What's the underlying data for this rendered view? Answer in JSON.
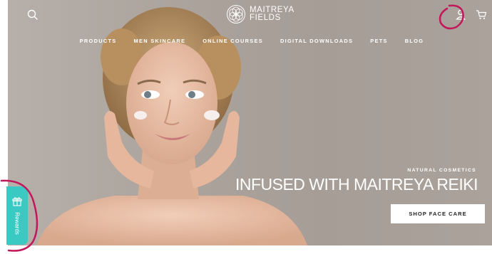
{
  "brand": {
    "line1": "MAITREYA",
    "line2": "FIELDS"
  },
  "header": {
    "icons": {
      "search": "search-icon",
      "account": "user-icon",
      "cart": "cart-icon"
    }
  },
  "nav": {
    "items": [
      {
        "label": "PRODUCTS"
      },
      {
        "label": "MEN SKINCARE"
      },
      {
        "label": "ONLINE COURSES"
      },
      {
        "label": "DIGITAL DOWNLOADS"
      },
      {
        "label": "PETS"
      },
      {
        "label": "BLOG"
      }
    ]
  },
  "hero": {
    "eyebrow": "NATURAL COSMETICS",
    "headline": "INFUSED WITH MAITREYA REIKI",
    "cta_label": "SHOP FACE CARE"
  },
  "rewards": {
    "label": "Rewards",
    "icon": "gift-icon"
  },
  "colors": {
    "hero_background": "#aaa29b",
    "rewards_teal": "#3ac9c3",
    "annotation_magenta": "#c2185b",
    "text_on_hero": "#ffffff"
  }
}
